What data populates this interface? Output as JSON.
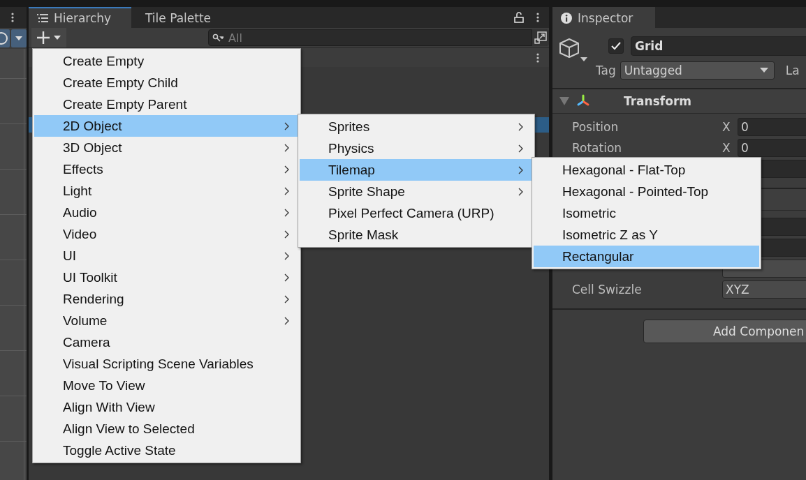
{
  "hierarchy": {
    "tabs": [
      {
        "label": "Hierarchy",
        "selected": true
      },
      {
        "label": "Tile Palette",
        "selected": false
      }
    ],
    "search": {
      "placeholder": "All"
    }
  },
  "menu": {
    "items": [
      {
        "label": "Create Empty",
        "submenu": false,
        "selected": false
      },
      {
        "label": "Create Empty Child",
        "submenu": false,
        "selected": false
      },
      {
        "label": "Create Empty Parent",
        "submenu": false,
        "selected": false
      },
      {
        "label": "2D Object",
        "submenu": true,
        "selected": true
      },
      {
        "label": "3D Object",
        "submenu": true,
        "selected": false
      },
      {
        "label": "Effects",
        "submenu": true,
        "selected": false
      },
      {
        "label": "Light",
        "submenu": true,
        "selected": false
      },
      {
        "label": "Audio",
        "submenu": true,
        "selected": false
      },
      {
        "label": "Video",
        "submenu": true,
        "selected": false
      },
      {
        "label": "UI",
        "submenu": true,
        "selected": false
      },
      {
        "label": "UI Toolkit",
        "submenu": true,
        "selected": false
      },
      {
        "label": "Rendering",
        "submenu": true,
        "selected": false
      },
      {
        "label": "Volume",
        "submenu": true,
        "selected": false
      },
      {
        "label": "Camera",
        "submenu": false,
        "selected": false
      },
      {
        "label": "Visual Scripting Scene Variables",
        "submenu": false,
        "selected": false
      },
      {
        "label": "Move To View",
        "submenu": false,
        "selected": false
      },
      {
        "label": "Align With View",
        "submenu": false,
        "selected": false
      },
      {
        "label": "Align View to Selected",
        "submenu": false,
        "selected": false
      },
      {
        "label": "Toggle Active State",
        "submenu": false,
        "selected": false
      }
    ]
  },
  "submenu": {
    "items": [
      {
        "label": "Sprites",
        "submenu": true,
        "selected": false
      },
      {
        "label": "Physics",
        "submenu": true,
        "selected": false
      },
      {
        "label": "Tilemap",
        "submenu": true,
        "selected": true
      },
      {
        "label": "Sprite Shape",
        "submenu": true,
        "selected": false
      },
      {
        "label": "Pixel Perfect Camera (URP)",
        "submenu": false,
        "selected": false
      },
      {
        "label": "Sprite Mask",
        "submenu": false,
        "selected": false
      }
    ]
  },
  "tilemap_menu": {
    "items": [
      {
        "label": "Hexagonal - Flat-Top",
        "submenu": false,
        "selected": false
      },
      {
        "label": "Hexagonal - Pointed-Top",
        "submenu": false,
        "selected": false
      },
      {
        "label": "Isometric",
        "submenu": false,
        "selected": false
      },
      {
        "label": "Isometric Z as Y",
        "submenu": false,
        "selected": false
      },
      {
        "label": "Rectangular",
        "submenu": false,
        "selected": true
      }
    ]
  },
  "inspector": {
    "tab": "Inspector",
    "active": true,
    "name": "Grid",
    "tag_label": "Tag",
    "tag_value": "Untagged",
    "layer_label": "La",
    "component": "Transform",
    "rows": [
      {
        "label": "Position",
        "axis": "X",
        "value": "0"
      },
      {
        "label": "Rotation",
        "axis": "X",
        "value": "0"
      }
    ],
    "grid_rows": [
      {
        "label": "Cell Swizzle",
        "value": "XYZ"
      }
    ],
    "add_button": "Add Componen"
  }
}
